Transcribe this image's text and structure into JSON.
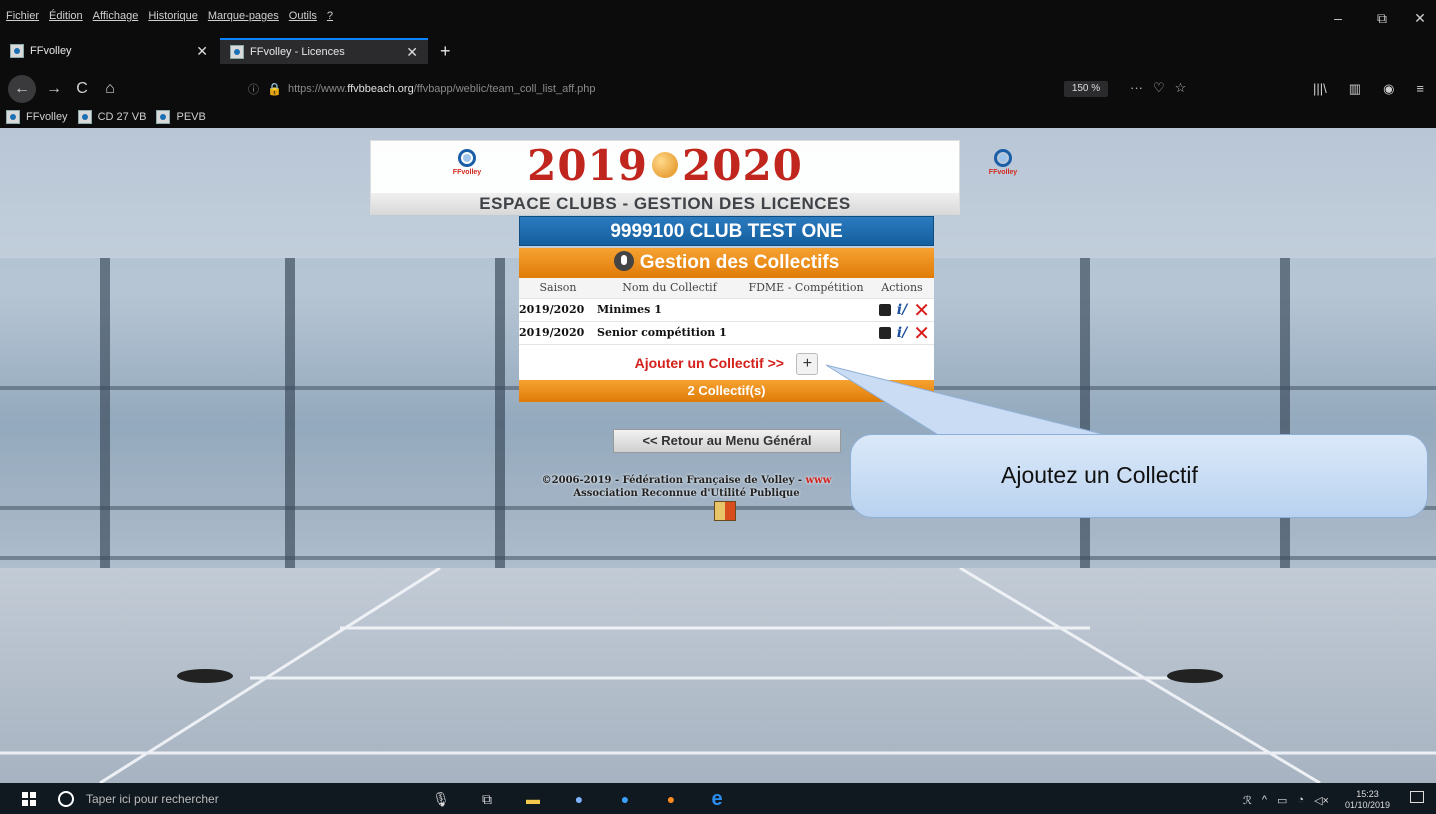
{
  "menubar": {
    "items": [
      "Fichier",
      "Édition",
      "Affichage",
      "Historique",
      "Marque-pages",
      "Outils",
      "?"
    ],
    "minimize": "–",
    "restore": "⧉",
    "close": "✕"
  },
  "tabs": [
    {
      "label": "FFvolley",
      "close": "✕"
    },
    {
      "label": "FFvolley - Licences",
      "close": "✕"
    }
  ],
  "new_tab": "+",
  "nav": {
    "back": "←",
    "forward": "→",
    "reload": "C",
    "home": "⌂",
    "info_icon": "ⓘ",
    "lock_icon": "🔒",
    "url_prefix": "https://www.",
    "url_domain": "ffvbbeach.org",
    "url_path": "/ffvbapp/weblic/team_coll_list_aff.php",
    "zoom": "150 %",
    "more": "···",
    "pocket": "♡",
    "star": "☆",
    "library": "|||\\",
    "sidebar": "▥",
    "account": "◉",
    "menu": "≡"
  },
  "bookmarks": [
    "FFvolley",
    "CD 27 VB",
    "PEVB"
  ],
  "page": {
    "year_left": "2019",
    "year_right": "2020",
    "logo_text": "FFvolley",
    "espace_title": "ESPACE CLUBS - GESTION DES LICENCES",
    "club_title": "9999100 CLUB TEST ONE",
    "gestion_title": "Gestion des Collectifs",
    "table_headers": [
      "Saison",
      "Nom du Collectif",
      "FDME - Compétition",
      "Actions"
    ],
    "rows": [
      {
        "season": "2019/2020",
        "name": "Minimes 1",
        "fdme": ""
      },
      {
        "season": "2019/2020",
        "name": "Senior compétition 1",
        "fdme": ""
      }
    ],
    "add_label": "Ajouter un Collectif >>",
    "add_button": "+",
    "count_label": "2 Collectif(s)",
    "retour_label": "<< Retour au Menu Général",
    "footer_line1": "©2006-2019 - Fédération Française de Volley - ",
    "footer_link": "www",
    "footer_line2": "Association Reconnue d'Utilité Publique",
    "callout_text": "Ajoutez un Collectif"
  },
  "taskbar": {
    "search_placeholder": "Taper ici pour rechercher",
    "time": "15:23",
    "date": "01/10/2019"
  },
  "colors": {
    "accent_blue": "#0a84ff",
    "club_blue": "#145f9e",
    "orange": "#e07b08",
    "red": "#d4201b"
  }
}
